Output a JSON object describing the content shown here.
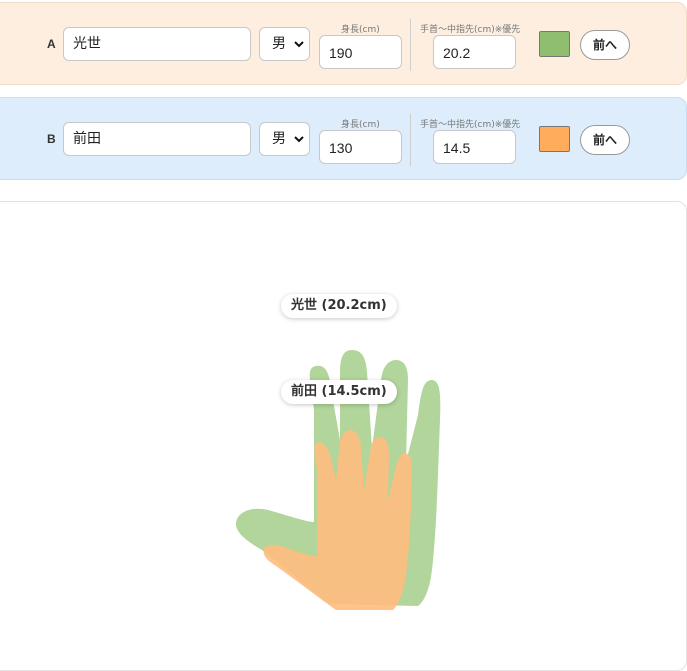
{
  "people": [
    {
      "letter": "A",
      "name": "光世",
      "sex": "男",
      "height_label": "身長(cm)",
      "height": "190",
      "hand_label": "手首〜中指先(cm)※優先",
      "hand_length": "20.2",
      "color": "#8fbf6e",
      "prev_label": "前へ",
      "tag": "光世 (20.2cm)"
    },
    {
      "letter": "B",
      "name": "前田",
      "sex": "男",
      "height_label": "身長(cm)",
      "height": "130",
      "hand_label": "手首〜中指先(cm)※優先",
      "hand_length": "14.5",
      "color": "#ffad5c",
      "prev_label": "前へ",
      "tag": "前田 (14.5cm)"
    }
  ],
  "icons": {
    "select_chevron": "chevron-down-icon"
  },
  "colors": {
    "row_a_bg": "#fdeee0",
    "row_b_bg": "#deedfb",
    "hand_a": "#a6cf8c",
    "hand_b": "#ffbd7e"
  }
}
